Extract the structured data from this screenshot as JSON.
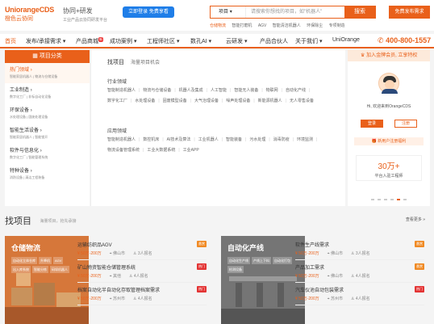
{
  "logo": {
    "brand": "UniorangeCDS",
    "sub": "橙色云协同"
  },
  "slogan": {
    "title": "协同+研发",
    "subtitle": "工业产品云协同研发平台"
  },
  "promo_badge": "立即登录 免费享看",
  "search": {
    "type": "项目",
    "placeholder": "请搜索你想找的项目，如\"机器人\"",
    "button": "搜索",
    "cta": "免费发布需求"
  },
  "hot_words": [
    "仓储物流",
    "智能打磨机",
    "AGV",
    "智能清洁机器人",
    "环保除尘",
    "专项制造"
  ],
  "nav": {
    "items": [
      "首页",
      "发布/承接需求",
      "产品商城",
      "成功案例",
      "工程师社区",
      "数孔AI",
      "云研发",
      "产品合伙人",
      "关于我们",
      "UniOrange"
    ],
    "new_badge": "新",
    "phone": "400-800-1557"
  },
  "sidebar": {
    "title": "项目分类",
    "categories": [
      {
        "title": "热门领域",
        "sub": "智能家居机器人 | 物流与仓储设备"
      },
      {
        "title": "工业制造",
        "sub": "数字化工厂 | 非标自动化设备"
      },
      {
        "title": "环保设备",
        "sub": "水处理设备 | 固废处理设备"
      },
      {
        "title": "智能生活设备",
        "sub": "智能家居机器人 | 智能锁开"
      },
      {
        "title": "软件与信息化",
        "sub": "数字化工厂 | 智能管理系统"
      },
      {
        "title": "特种设备",
        "sub": "消防设备 | 清洁工程装备"
      }
    ]
  },
  "panel": {
    "tab_active": "找项目",
    "tab_other": "海量项目机会",
    "industry_title": "行业领域",
    "industry": [
      "智能制造机器人",
      "物流与仓储设备",
      "机器人及集成",
      "人工智能",
      "智能无人装备",
      "物联网",
      "自动化产线",
      "数字化工厂",
      "水处理设备",
      "固废模型设备",
      "大气治理设备",
      "噪声处理设备",
      "新能源机器人",
      "无人零售设备"
    ],
    "app_title": "应用领域",
    "app": [
      "智能制造机器人",
      "数控机床",
      "AI技术及算法",
      "工业机器人",
      "智能装备",
      "污水处理",
      "消毒防疫",
      "环境监测",
      "物流设备管理系统",
      "工业大数据系统",
      "工业APP"
    ]
  },
  "right": {
    "vip": "加入金牌会员, 立享特权",
    "welcome": "Hi, 欢迎来到OrangeCDS",
    "login": "登录",
    "register": "注册",
    "newbie": "新用户注册福利",
    "stat_number": "30万+",
    "stat_label": "平台入驻工程师"
  },
  "section": {
    "title": "找项目",
    "subtitle": "海量项目，抢先承接",
    "more": "查看更多 »"
  },
  "cards": [
    {
      "title": "仓储物流",
      "tags": [
        "自动化立体仓库",
        "升降机",
        "AGV",
        "出入库系统",
        "智能分拣",
        "码垛机器人"
      ],
      "color": "#d6773a"
    },
    {
      "title": "自动化产线",
      "tags": [
        "自动化生产线",
        "产线上下料",
        "自动化打包",
        "检测设备"
      ],
      "color": "#757575"
    }
  ],
  "projects_left": [
    {
      "name": "运输纺织品AGV",
      "tag": "悬赏",
      "price": "¥ 50万-200万",
      "city": "佛山市",
      "count": "3人报名"
    },
    {
      "name": "矿山物资智能仓储管理系统",
      "tag": "热门",
      "price": "¥ 50万-200万",
      "city": "其他",
      "count": "4人报名"
    },
    {
      "name": "档案自动化半自动化存取管理档案需求",
      "tag": "热门",
      "price": "¥ 50万-200万",
      "city": "苏州市",
      "count": "4人报名"
    }
  ],
  "projects_right": [
    {
      "name": "软件生产线需求",
      "tag": "悬赏",
      "price": "¥ 50万-200万",
      "city": "佛山市",
      "count": "3人报名"
    },
    {
      "name": "产品加工需求",
      "tag": "悬赏",
      "price": "¥ 50万-200万",
      "city": "佛山市",
      "count": "4人报名"
    },
    {
      "name": "汽车仪池自动包装需求",
      "tag": "热门",
      "price": "¥ 50万-200万",
      "city": "苏州市",
      "count": "4人报名"
    }
  ],
  "colors": {
    "accent": "#e9601a",
    "hot_tag": "#e33333",
    "reward_tag": "#f08a24"
  }
}
